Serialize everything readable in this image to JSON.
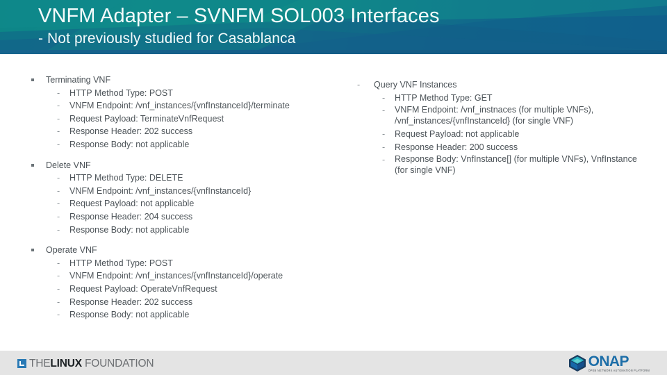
{
  "header": {
    "title": "VNFM Adapter – SVNFM SOL003 Interfaces",
    "subtitle": "- Not previously studied for Casablanca"
  },
  "markers": {
    "square": "▪",
    "dash": "-"
  },
  "left_column": [
    {
      "heading": "Terminating VNF",
      "items": [
        {
          "text": "HTTP Method Type: POST"
        },
        {
          "text": "VNFM Endpoint: /vnf_instances/{vnfInstanceId}/terminate"
        },
        {
          "text": "Request Payload: TerminateVnfRequest"
        },
        {
          "text": "Response Header: 202 success"
        },
        {
          "text": "Response Body: not applicable"
        }
      ]
    },
    {
      "heading": "Delete VNF",
      "items": [
        {
          "text": "HTTP Method Type: DELETE"
        },
        {
          "text": "VNFM Endpoint: /vnf_instances/{vnfInstanceId}"
        },
        {
          "text": "Request Payload: not applicable"
        },
        {
          "text": "Response Header: 204 success"
        },
        {
          "text": "Response Body: not applicable"
        }
      ]
    },
    {
      "heading": "Operate VNF",
      "items": [
        {
          "text": "HTTP Method Type: POST"
        },
        {
          "text": "VNFM Endpoint: /vnf_instances/{vnfInstanceId}/operate"
        },
        {
          "text": "Request Payload: OperateVnfRequest"
        },
        {
          "text": "Response Header: 202 success"
        },
        {
          "text": "Response Body: not applicable"
        }
      ]
    }
  ],
  "right_column": [
    {
      "heading": "Query VNF Instances",
      "items": [
        {
          "text": "HTTP Method Type: GET"
        },
        {
          "line1": "VNFM Endpoint: /vnf_instnaces  (for multiple VNFs),",
          "line2": "/vnf_instances/{vnfInstanceId}  (for single VNF)"
        },
        {
          "text": "Request Payload: not applicable"
        },
        {
          "text": "Response Header: 200 success"
        },
        {
          "line1": "Response Body: VnfInstance[] (for multiple VNFs), VnfInstance",
          "line2": "(for single VNF)"
        }
      ]
    }
  ],
  "footer": {
    "linux_foundation": {
      "the": "THE",
      "linux": "LINUX",
      "foundation": " FOUNDATION"
    },
    "onap": {
      "word": "ONAP",
      "tagline": "OPEN NETWORK AUTOMATION PLATFORM"
    }
  },
  "colors": {
    "header_teal": "#0d8e86",
    "header_blue": "#11628c",
    "body_text": "#4c5358",
    "footer_bg": "#e4e4e4",
    "onap_blue": "#1d6ea8",
    "lf_blue": "#2a7ab5"
  }
}
